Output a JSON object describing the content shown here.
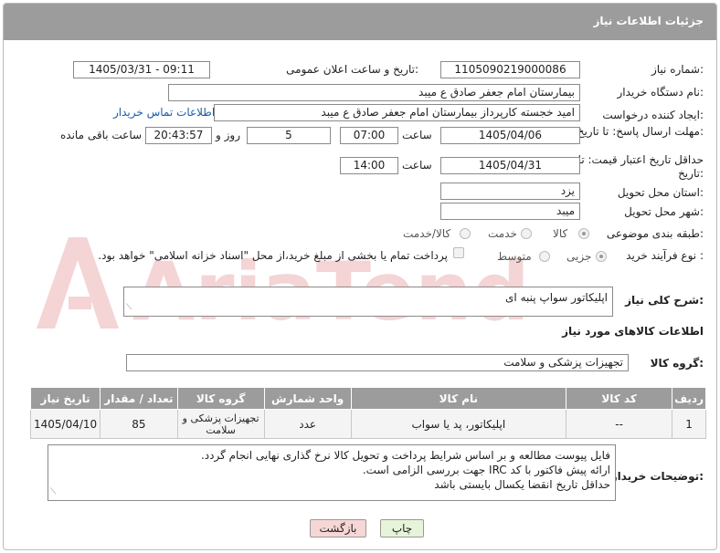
{
  "header": {
    "title": "جزئیات اطلاعات نیاز"
  },
  "fields": {
    "need_number_label": "شماره نیاز:",
    "need_number": "1105090219000086",
    "announce_label": "تاریخ و ساعت اعلان عمومی:",
    "announce_value": "1405/03/31 - 09:11",
    "buyer_label": "نام دستگاه خریدار:",
    "buyer_value": "بیمارستان امام جعفر صادق  ع  میبد",
    "creator_label": "ایجاد کننده درخواست:",
    "creator_value": "امید خجسته کارپرداز بیمارستان امام جعفر صادق  ع  میبد",
    "contact_link": "اطلاعات تماس خریدار",
    "deadline_label": "مهلت ارسال پاسخ: تا تاریخ:",
    "deadline_date": "1405/04/06",
    "time_label": "ساعت",
    "deadline_time": "07:00",
    "days_value": "5",
    "days_label": "روز و",
    "remaining_time": "20:43:57",
    "remaining_label": "ساعت باقی مانده",
    "validity_label": "حداقل تاریخ اعتبار قیمت: تا تاریخ:",
    "validity_date": "1405/04/31",
    "validity_time": "14:00",
    "province_label": "استان محل تحویل:",
    "province_value": "یزد",
    "city_label": "شهر محل تحویل:",
    "city_value": "میبد",
    "category_label": "طبقه بندی موضوعی:",
    "category_options": [
      "کالا",
      "خدمت",
      "کالا/خدمت"
    ],
    "category_selected": "کالا",
    "process_label": "نوع فرآیند خرید :",
    "process_options": [
      "جزیی",
      "متوسط"
    ],
    "process_selected": "جزیی",
    "payment_text": "پرداخت تمام یا بخشی از مبلغ خرید،از محل \"اسناد خزانه اسلامی\" خواهد بود."
  },
  "description": {
    "label": "شرح کلی نیاز:",
    "value": "اپلیکاتور سواپ پنبه ای"
  },
  "goods_section": {
    "title": "اطلاعات کالاهای مورد نیاز",
    "group_label": "گروه کالا:",
    "group_value": "تجهیزات پزشکی و سلامت"
  },
  "table": {
    "headers": [
      "ردیف",
      "کد کالا",
      "نام کالا",
      "واحد شمارش",
      "گروه کالا",
      "تعداد / مقدار",
      "تاریخ نیاز"
    ],
    "rows": [
      {
        "row": "1",
        "code": "--",
        "name": "اپلیکاتور، پد یا سواب",
        "unit": "عدد",
        "group": "تجهیزات پزشکی و سلامت",
        "qty": "85",
        "date": "1405/04/10"
      }
    ]
  },
  "notes": {
    "label": "توضیحات خریدار:",
    "lines": [
      "فایل پیوست مطالعه و بر اساس شرایط پرداخت و تحویل کالا نرخ گذاری نهایی انجام گردد.",
      "ارائه پیش فاکتور با کد IRC جهت بررسی الزامی است.",
      "حداقل تاریخ انقضا یکسال بایستی باشد"
    ]
  },
  "buttons": {
    "print": "چاپ",
    "back": "بازگشت"
  },
  "watermark": {
    "text": "AriaTender.net"
  },
  "colors": {
    "header_bg": "#9c9c9c",
    "link": "#1a5ca8",
    "back_bg": "#f7d6d6",
    "print_bg": "#e6f4d9"
  }
}
